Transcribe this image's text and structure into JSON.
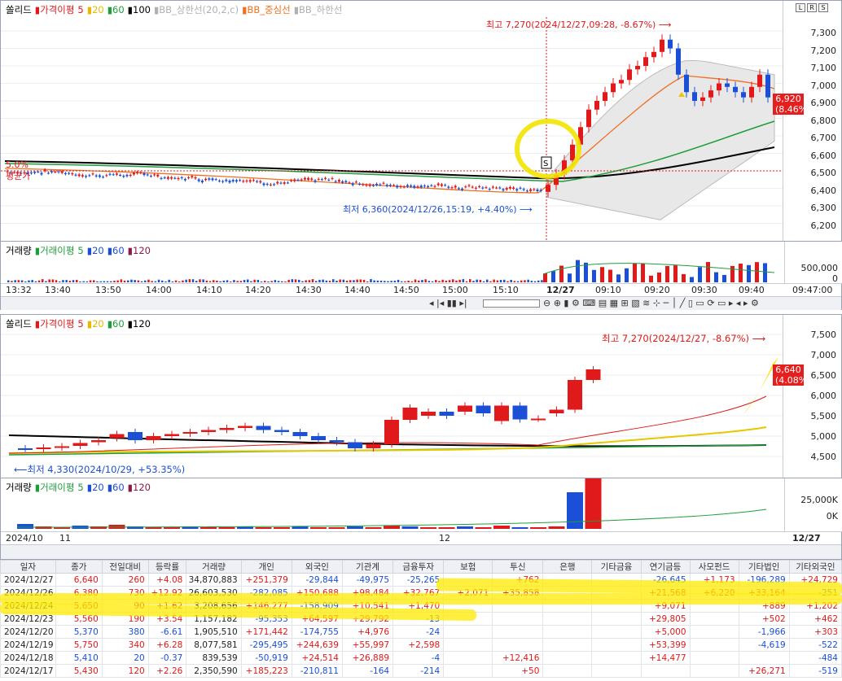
{
  "top_chart": {
    "legend": [
      {
        "label": "쏠리드",
        "color": "#000000"
      },
      {
        "label": "가격이평",
        "color": "#e0191a"
      },
      {
        "label": "5",
        "color": "#e0191a"
      },
      {
        "label": "20",
        "color": "#e6b800"
      },
      {
        "label": "60",
        "color": "#1e9e3a"
      },
      {
        "label": "100",
        "color": "#000000"
      },
      {
        "label": "BB_상한선(20,2,c)",
        "color": "#b0b0b0"
      },
      {
        "label": "BB_중심선",
        "color": "#f07020"
      },
      {
        "label": "BB_하한선",
        "color": "#b0b0b0"
      }
    ],
    "y_ticks": [
      "7,300",
      "7,200",
      "7,100",
      "7,000",
      "6,900",
      "6,800",
      "6,700",
      "6,600",
      "6,500",
      "6,400",
      "6,300",
      "6,200"
    ],
    "high_label": "최고 7,270(2024/12/27,09:28, -8.67%)",
    "low_label": "최저 6,360(2024/12/26,15:19, +4.40%)",
    "left_note_1": "5.0%",
    "left_note_2": "평균가",
    "current_price": "6,920",
    "current_pct": "(8.46%)",
    "volume_legend": [
      {
        "label": "거래량",
        "color": "#000000"
      },
      {
        "label": "거래이평",
        "color": "#1e9e3a"
      },
      {
        "label": "5",
        "color": "#1e9e3a"
      },
      {
        "label": "20",
        "color": "#1a4fd6"
      },
      {
        "label": "60",
        "color": "#1a4fd6"
      },
      {
        "label": "120",
        "color": "#8b1a4a"
      }
    ],
    "volume_ticks": [
      "500,000",
      "0"
    ],
    "x_ticks": [
      "13:32",
      "13:40",
      "13:50",
      "14:00",
      "14:10",
      "14:20",
      "14:30",
      "14:40",
      "14:50",
      "15:00",
      "15:10",
      "12/27",
      "09:10",
      "09:20",
      "09:30",
      "09:40",
      "09:47:00"
    ],
    "axis_buttons": [
      "L",
      "R",
      "S"
    ]
  },
  "bottom_chart": {
    "legend": [
      {
        "label": "쏠리드",
        "color": "#000000"
      },
      {
        "label": "가격이평",
        "color": "#e0191a"
      },
      {
        "label": "5",
        "color": "#e0191a"
      },
      {
        "label": "20",
        "color": "#e6b800"
      },
      {
        "label": "60",
        "color": "#1e9e3a"
      },
      {
        "label": "120",
        "color": "#000000"
      }
    ],
    "y_ticks": [
      "7,500",
      "7,000",
      "6,500",
      "6,000",
      "5,500",
      "5,000",
      "4,500"
    ],
    "high_label": "최고 7,270(2024/12/27, -8.67%)",
    "low_label": "최저 4,330(2024/10/29, +53.35%)",
    "current_price": "6,640",
    "current_pct": "(4.08%)",
    "volume_legend": [
      {
        "label": "거래량",
        "color": "#000000"
      },
      {
        "label": "거래이평",
        "color": "#1e9e3a"
      },
      {
        "label": "5",
        "color": "#1e9e3a"
      },
      {
        "label": "20",
        "color": "#1a4fd6"
      },
      {
        "label": "60",
        "color": "#1a4fd6"
      },
      {
        "label": "120",
        "color": "#8b1a4a"
      }
    ],
    "volume_ticks": [
      "25,000K",
      "0K"
    ],
    "x_ticks": [
      "2024/10",
      "11",
      "12",
      "12/27"
    ]
  },
  "table": {
    "headers": [
      "일자",
      "종가",
      "전일대비",
      "등락률",
      "거래량",
      "개인",
      "외국인",
      "기관계",
      "금융투자",
      "보험",
      "투신",
      "은행",
      "기타금융",
      "연기금등",
      "사모펀드",
      "기타법인",
      "기타외국인"
    ],
    "rows": [
      [
        "2024/12/27",
        "6,640",
        "260",
        "+4.08",
        "34,870,883",
        "+251,379",
        "-29,844",
        "-49,975",
        "-25,265",
        "",
        "+762",
        "",
        "",
        "-26,645",
        "+1,173",
        "-196,289",
        "+24,729"
      ],
      [
        "2024/12/26",
        "6,380",
        "730",
        "+12.92",
        "26,603,530",
        "-282,085",
        "+150,688",
        "+98,484",
        "+32,767",
        "+2,071",
        "+35,858",
        "",
        "",
        "+21,568",
        "+6,220",
        "+33,164",
        "-251"
      ],
      [
        "2024/12/24",
        "5,650",
        "90",
        "+1.62",
        "3,208,656",
        "+146,277",
        "-158,909",
        "+10,541",
        "+1,470",
        "",
        "",
        "",
        "",
        "+9,071",
        "",
        "+889",
        "+1,202"
      ],
      [
        "2024/12/23",
        "5,560",
        "190",
        "+3.54",
        "1,157,182",
        "-95,353",
        "+64,597",
        "+29,792",
        "-13",
        "",
        "",
        "",
        "",
        "+29,805",
        "",
        "+502",
        "+462"
      ],
      [
        "2024/12/20",
        "5,370",
        "380",
        "-6.61",
        "1,905,510",
        "+171,442",
        "-174,755",
        "+4,976",
        "-24",
        "",
        "",
        "",
        "",
        "+5,000",
        "",
        "-1,966",
        "+303"
      ],
      [
        "2024/12/19",
        "5,750",
        "340",
        "+6.28",
        "8,077,581",
        "-295,495",
        "+244,639",
        "+55,997",
        "+2,598",
        "",
        "",
        "",
        "",
        "+53,399",
        "",
        "-4,619",
        "-522"
      ],
      [
        "2024/12/18",
        "5,410",
        "20",
        "-0.37",
        "839,539",
        "-50,919",
        "+24,514",
        "+26,889",
        "-4",
        "",
        "+12,416",
        "",
        "",
        "+14,477",
        "",
        "",
        "-484"
      ],
      [
        "2024/12/17",
        "5,430",
        "120",
        "+2.26",
        "2,350,590",
        "+185,223",
        "-210,811",
        "-164",
        "-214",
        "",
        "+50",
        "",
        "",
        "",
        "",
        "+26,271",
        "-519"
      ]
    ]
  }
}
